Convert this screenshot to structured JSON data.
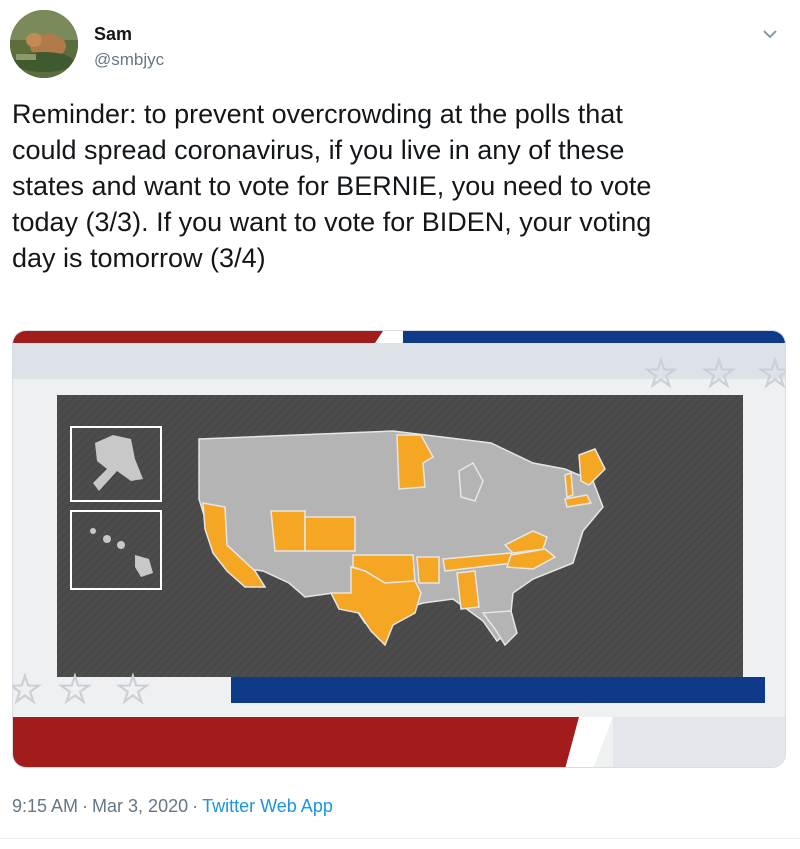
{
  "author": {
    "name": "Sam",
    "handle": "@smbjyc"
  },
  "tweet": {
    "text": "Reminder: to prevent overcrowding at the polls that\ncould spread coronavirus, if you live in any of these\nstates and want to vote for BERNIE, you need to vote\ntoday (3/3). If you want to vote for BIDEN, your voting\nday is tomorrow (3/4)"
  },
  "meta": {
    "time": "9:15 AM",
    "separator": "·",
    "date": "Mar 3, 2020",
    "source": "Twitter Web App"
  },
  "icons": {
    "menu": "chevron-down-icon",
    "avatar": "profile-photo"
  },
  "colors": {
    "highlight_state": "#f5a623",
    "default_state": "#b4b4b4",
    "map_background": "#4a4a4a",
    "banner_red": "#a31c1c",
    "banner_blue": "#0f3a8a",
    "link": "#1b95e0"
  },
  "map": {
    "highlighted_states": [
      "California",
      "Utah",
      "Colorado",
      "Texas",
      "Oklahoma",
      "Arkansas",
      "Minnesota",
      "Tennessee",
      "Alabama",
      "North Carolina",
      "Virginia",
      "Vermont",
      "Maine",
      "Massachusetts"
    ]
  }
}
